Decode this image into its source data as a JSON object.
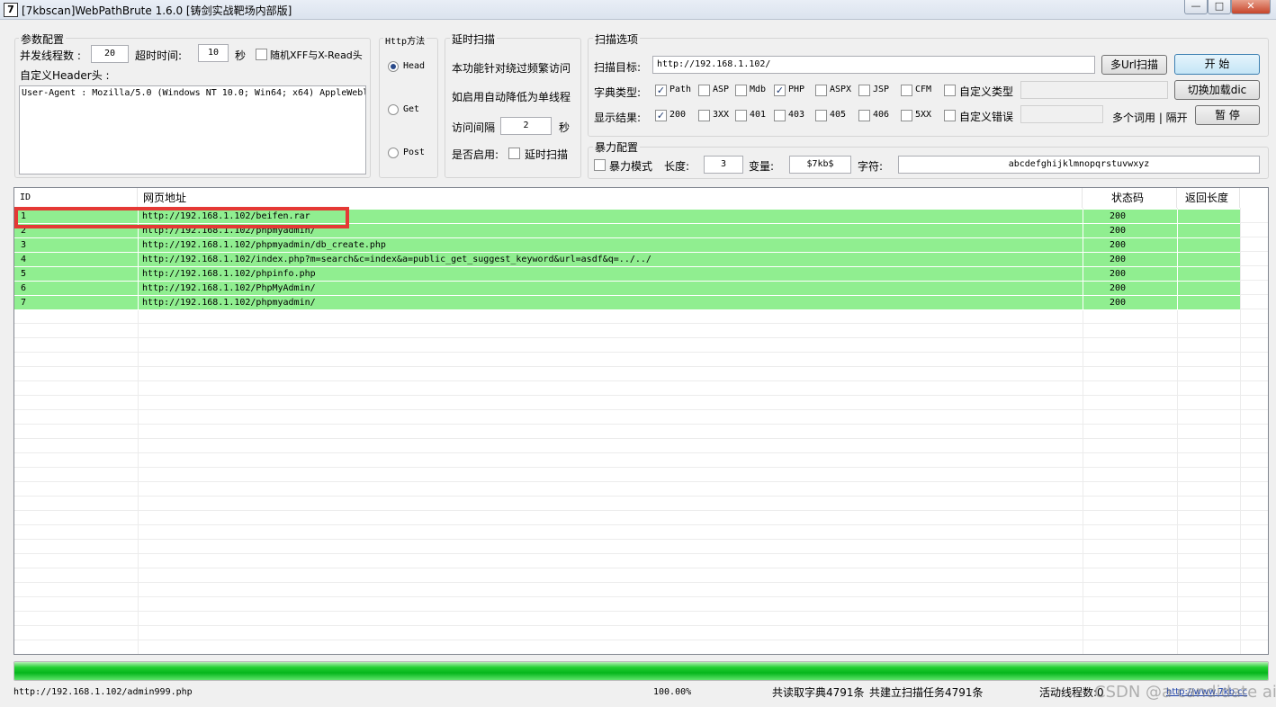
{
  "window": {
    "title": "[7kbscan]WebPathBrute 1.6.0 [铸剑实战靶场内部版]",
    "icon_text": "7",
    "min_glyph": "—",
    "max_glyph": "□",
    "close_glyph": "✕"
  },
  "params": {
    "group_title": "参数配置",
    "threads_label": "并发线程数 :",
    "threads_value": "20",
    "timeout_label": "超时时间:",
    "timeout_value": "10",
    "timeout_unit": "秒",
    "random_xff_label": "随机XFF与X-Read头",
    "header_label": "自定义Header头 :",
    "header_value": "User-Agent : Mozilla/5.0 (Windows NT 10.0; Win64; x64) AppleWebl"
  },
  "http_method": {
    "group_title": "Http方法",
    "options": [
      "Head",
      "Get",
      "Post"
    ],
    "selected": "Head"
  },
  "delay": {
    "group_title": "延时扫描",
    "desc1": "本功能针对绕过频繁访问",
    "desc2": "如启用自动降低为单线程",
    "interval_label": "访问间隔",
    "interval_value": "2",
    "interval_unit": "秒",
    "enable_label": "是否启用:",
    "enable_cb_label": "延时扫描"
  },
  "scan_options": {
    "group_title": "扫描选项",
    "target_label": "扫描目标:",
    "target_value": "http://192.168.1.102/",
    "multi_url_button": "多Url扫描",
    "start_button": "开 始",
    "dict_type_label": "字典类型:",
    "dict_types": [
      {
        "label": "Path",
        "checked": true
      },
      {
        "label": "ASP",
        "checked": false
      },
      {
        "label": "Mdb",
        "checked": false
      },
      {
        "label": "PHP",
        "checked": true
      },
      {
        "label": "ASPX",
        "checked": false
      },
      {
        "label": "JSP",
        "checked": false
      },
      {
        "label": "CFM",
        "checked": false
      }
    ],
    "custom_type_label": "自定义类型",
    "switch_dic_button": "切换加载dic",
    "display_label": "显示结果:",
    "display_codes": [
      {
        "label": "200",
        "checked": true
      },
      {
        "label": "3XX",
        "checked": false
      },
      {
        "label": "401",
        "checked": false
      },
      {
        "label": "403",
        "checked": false
      },
      {
        "label": "405",
        "checked": false
      },
      {
        "label": "406",
        "checked": false
      },
      {
        "label": "5XX",
        "checked": false
      }
    ],
    "custom_error_label": "自定义错误",
    "multi_word_label": "多个词用 | 隔开",
    "pause_button": "暂 停"
  },
  "brute": {
    "group_title": "暴力配置",
    "mode_label": "暴力模式",
    "length_label": "长度:",
    "length_value": "3",
    "var_label": "变量:",
    "var_value": "$7kb$",
    "chars_label": "字符:",
    "chars_value": "abcdefghijklmnopqrstuvwxyz"
  },
  "results": {
    "columns": [
      "ID",
      "网页地址",
      "状态码",
      "返回长度"
    ],
    "rows": [
      {
        "id": "1",
        "url": "http://192.168.1.102/beifen.rar",
        "status": "200",
        "length": ""
      },
      {
        "id": "2",
        "url": "http://192.168.1.102/phpmyadmin/",
        "status": "200",
        "length": ""
      },
      {
        "id": "3",
        "url": "http://192.168.1.102/phpmyadmin/db_create.php",
        "status": "200",
        "length": ""
      },
      {
        "id": "4",
        "url": "http://192.168.1.102/index.php?m=search&c=index&a=public_get_suggest_keyword&url=asdf&q=../../",
        "status": "200",
        "length": ""
      },
      {
        "id": "5",
        "url": "http://192.168.1.102/phpinfo.php",
        "status": "200",
        "length": ""
      },
      {
        "id": "6",
        "url": "http://192.168.1.102/PhpMyAdmin/",
        "status": "200",
        "length": ""
      },
      {
        "id": "7",
        "url": "http://192.168.1.102/phpmyadmin/",
        "status": "200",
        "length": ""
      }
    ],
    "highlight_color": "#e53935",
    "row_color": "#90ee90"
  },
  "progress": {
    "fraction": 1.0
  },
  "statusbar": {
    "current_url": "http://192.168.1.102/admin999.php",
    "percent": "100.00%",
    "dict_count": "共读取字典4791条",
    "task_count": "共建立扫描任务4791条",
    "active_threads": "活动线程数:0",
    "watermark": "CSDN @a candidate ai",
    "link": "http://www.7kb.cc"
  }
}
